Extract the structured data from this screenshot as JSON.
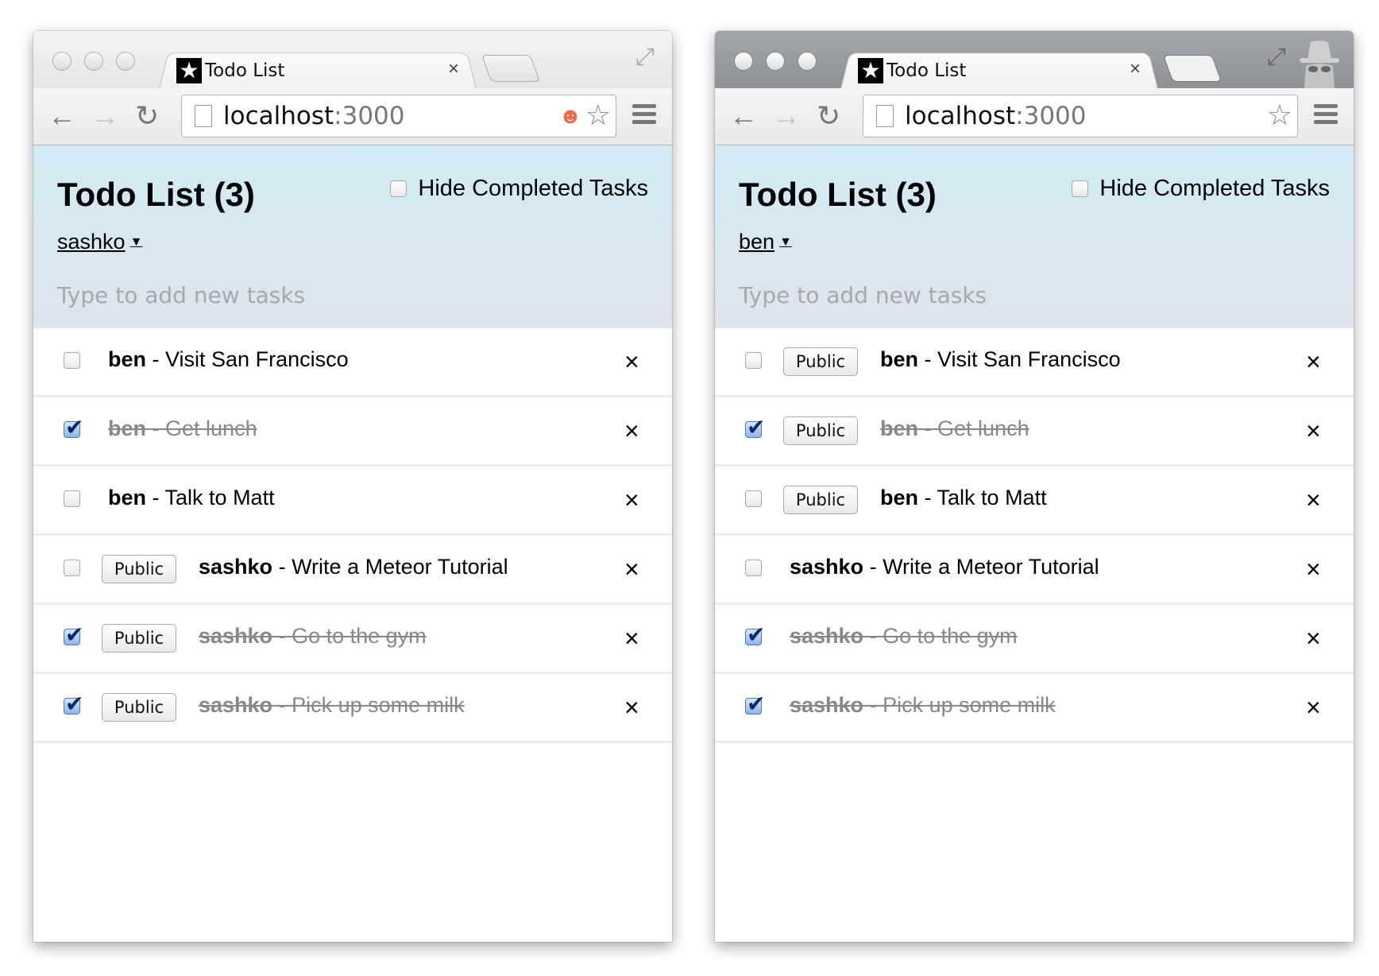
{
  "windows": [
    {
      "incognito": false,
      "tab_title": "Todo List",
      "tab_close": "×",
      "url_host": "localhost",
      "url_port": ":3000",
      "extension_icon": "reddit-alien-icon",
      "title": "Todo List (3)",
      "hide_completed_label": "Hide Completed Tasks",
      "hide_completed_checked": false,
      "user": "sashko",
      "new_task_placeholder": "Type to add new tasks",
      "tasks": [
        {
          "owner": "ben",
          "separator": " - ",
          "text": "Visit San Francisco",
          "checked": false,
          "badge": null
        },
        {
          "owner": "ben",
          "separator": " - ",
          "text": "Get lunch",
          "checked": true,
          "badge": null
        },
        {
          "owner": "ben",
          "separator": " - ",
          "text": "Talk to Matt",
          "checked": false,
          "badge": null
        },
        {
          "owner": "sashko",
          "separator": " - ",
          "text": "Write a Meteor Tutorial",
          "checked": false,
          "badge": "Public"
        },
        {
          "owner": "sashko",
          "separator": " - ",
          "text": "Go to the gym",
          "checked": true,
          "badge": "Public"
        },
        {
          "owner": "sashko",
          "separator": " - ",
          "text": "Pick up some milk",
          "checked": true,
          "badge": "Public"
        }
      ]
    },
    {
      "incognito": true,
      "tab_title": "Todo List",
      "tab_close": "×",
      "url_host": "localhost",
      "url_port": ":3000",
      "title": "Todo List (3)",
      "hide_completed_label": "Hide Completed Tasks",
      "hide_completed_checked": false,
      "user": "ben",
      "new_task_placeholder": "Type to add new tasks",
      "tasks": [
        {
          "owner": "ben",
          "separator": " - ",
          "text": "Visit San Francisco",
          "checked": false,
          "badge": "Public"
        },
        {
          "owner": "ben",
          "separator": " - ",
          "text": "Get lunch",
          "checked": true,
          "badge": "Public"
        },
        {
          "owner": "ben",
          "separator": " - ",
          "text": "Talk to Matt",
          "checked": false,
          "badge": "Public"
        },
        {
          "owner": "sashko",
          "separator": " - ",
          "text": "Write a Meteor Tutorial",
          "checked": false,
          "badge": null
        },
        {
          "owner": "sashko",
          "separator": " - ",
          "text": "Go to the gym",
          "checked": true,
          "badge": null
        },
        {
          "owner": "sashko",
          "separator": " - ",
          "text": "Pick up some milk",
          "checked": true,
          "badge": null
        }
      ]
    }
  ],
  "delete_glyph": "×",
  "caret_glyph": "▼"
}
